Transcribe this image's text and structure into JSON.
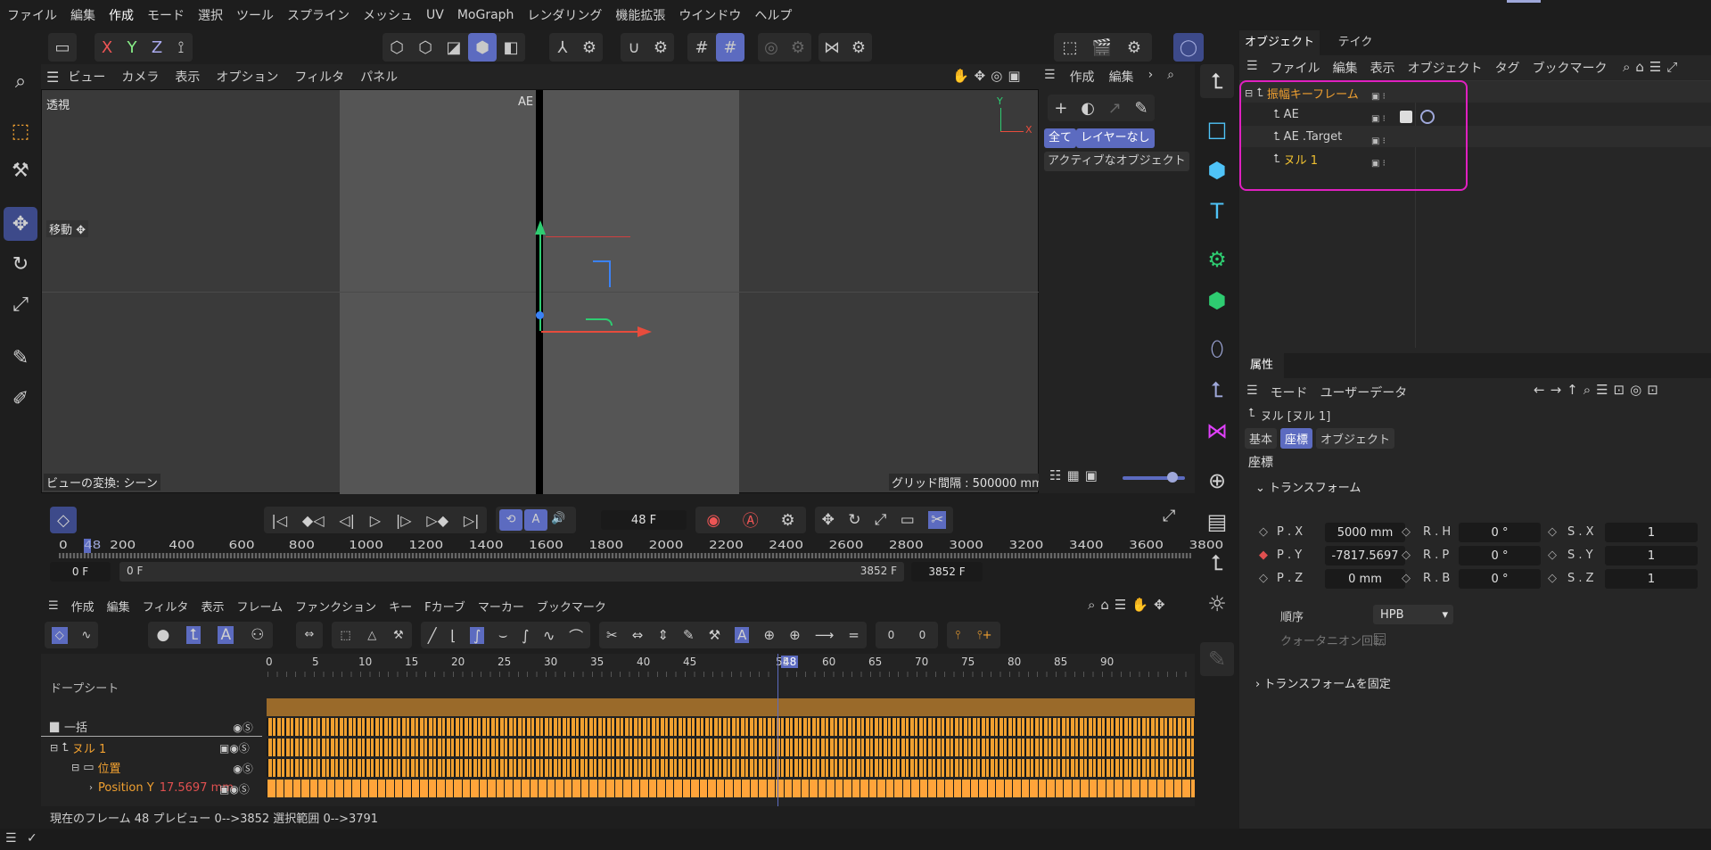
{
  "menubar": [
    "ファイル",
    "編集",
    "作成",
    "モード",
    "選択",
    "ツール",
    "スプライン",
    "メッシュ",
    "UV",
    "MoGraph",
    "レンダリング",
    "機能拡張",
    "ウインドウ",
    "ヘルプ"
  ],
  "viewport": {
    "menu": [
      "ビュー",
      "カメラ",
      "表示",
      "オプション",
      "フィルタ",
      "パネル"
    ],
    "label": "透視",
    "move_label": "移動",
    "camera_label": "AE",
    "bottom_left": "ビューの変換: シーン",
    "grid_text": "グリッド間隔 : 500000 mm",
    "axis_y": "Y",
    "axis_x": "X"
  },
  "midpanel": {
    "menu": [
      "作成",
      "編集"
    ],
    "btn_all": "全て",
    "btn_nolayer": "レイヤーなし",
    "active_obj": "アクティブなオブジェクト"
  },
  "objects": {
    "tabs": [
      "オブジェクト",
      "テイク"
    ],
    "menu": [
      "ファイル",
      "編集",
      "表示",
      "オブジェクト",
      "タグ",
      "ブックマーク"
    ],
    "items": [
      {
        "name": "振幅キーフレーム",
        "color": "#f0a030"
      },
      {
        "name": "AE",
        "color": "#cfcfcf"
      },
      {
        "name": "AE .Target",
        "color": "#cfcfcf"
      },
      {
        "name": "ヌル 1",
        "color": "#f0c030"
      }
    ]
  },
  "attributes": {
    "tab": "属性",
    "menu": [
      "モード",
      "ユーザーデータ"
    ],
    "title": "ヌル [ヌル 1]",
    "subtabs": [
      "基本",
      "座標",
      "オブジェクト"
    ],
    "section": "座標",
    "transform": "トランスフォーム",
    "rows": [
      {
        "p": "P . X",
        "pv": "5000 mm",
        "r": "R . H",
        "rv": "0 °",
        "s": "S . X",
        "sv": "1"
      },
      {
        "p": "P . Y",
        "pv": "-7817.5697",
        "r": "R . P",
        "rv": "0 °",
        "s": "S . Y",
        "sv": "1"
      },
      {
        "p": "P . Z",
        "pv": "0 mm",
        "r": "R . B",
        "rv": "0 °",
        "s": "S . Z",
        "sv": "1"
      }
    ],
    "order_label": "順序",
    "order_value": "HPB",
    "quat": "クォータニオン回転",
    "freeze": "トランスフォームを固定"
  },
  "timeline": {
    "frame": "48 F",
    "ruler": [
      "0",
      "48",
      "200",
      "400",
      "600",
      "800",
      "1000",
      "1200",
      "1400",
      "1600",
      "1800",
      "2000",
      "2200",
      "2400",
      "2600",
      "2800",
      "3000",
      "3200",
      "3400",
      "3600",
      "3800"
    ],
    "start_field": "0 F",
    "range_start": "0 F",
    "range_end": "3852 F",
    "end_field": "3852 F"
  },
  "dope": {
    "menu": [
      "作成",
      "編集",
      "フィルタ",
      "表示",
      "フレーム",
      "ファンクション",
      "キー",
      "Fカーブ",
      "マーカー",
      "ブックマーク"
    ],
    "title": "ドープシート",
    "ticks": [
      "0",
      "5",
      "10",
      "15",
      "20",
      "25",
      "30",
      "35",
      "40",
      "45",
      "48",
      "55",
      "60",
      "65",
      "70",
      "75",
      "80",
      "85",
      "90"
    ],
    "tracks": [
      "一括",
      "ヌル 1",
      "位置",
      "Position Y"
    ],
    "posy_value": "17.5697 mm"
  },
  "status": {
    "text": "現在のフレーム 48 プレビュー 0-->3852  選択範囲 0-->3791"
  },
  "colors": {
    "accent": "#5c6bc0",
    "highlight_box": "#e020c0",
    "orange": "#f0a030",
    "key": "#ffa43a"
  }
}
